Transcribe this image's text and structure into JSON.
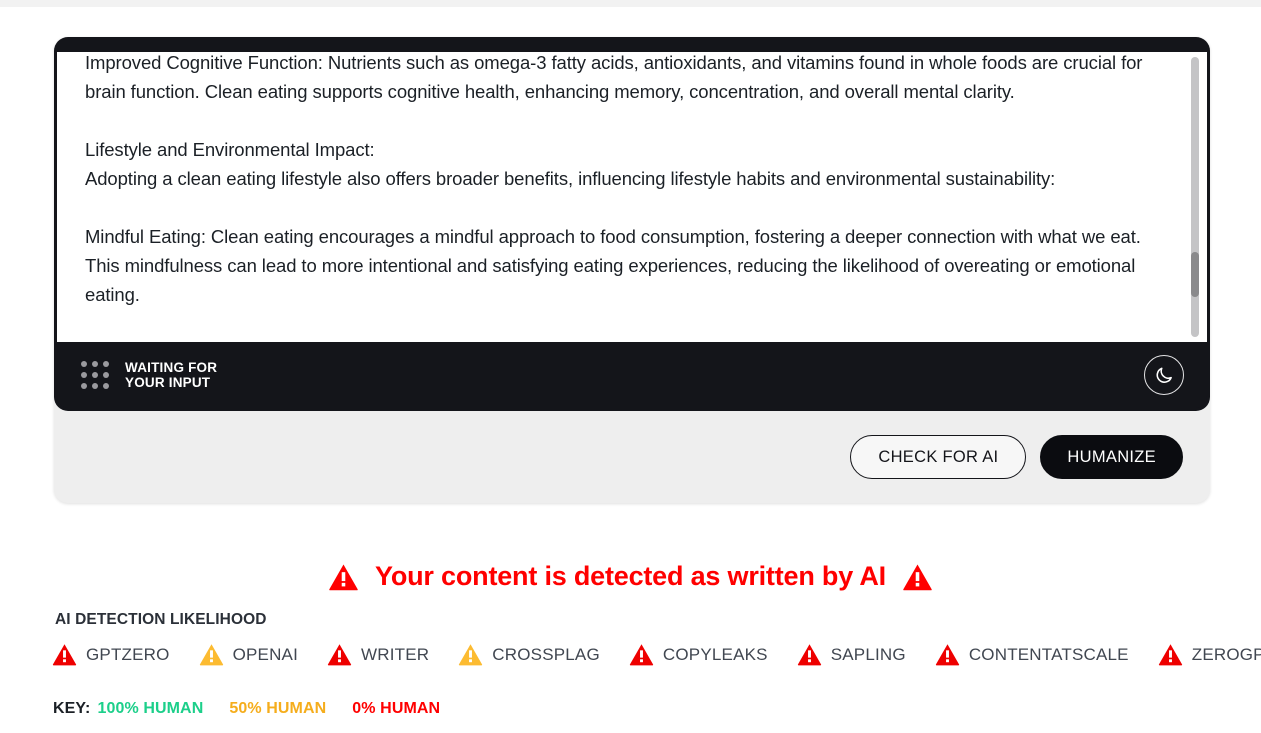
{
  "editor": {
    "body_text": "Improved Cognitive Function: Nutrients such as omega-3 fatty acids, antioxidants, and vitamins found in whole foods are crucial for brain function. Clean eating supports cognitive health, enhancing memory, concentration, and overall mental clarity.\n\nLifestyle and Environmental Impact:\nAdopting a clean eating lifestyle also offers broader benefits, influencing lifestyle habits and environmental sustainability:\n\nMindful Eating: Clean eating encourages a mindful approach to food consumption, fostering a deeper connection with what we eat. This mindfulness can lead to more intentional and satisfying eating experiences, reducing the likelihood of overeating or emotional eating.",
    "status_line1": "WAITING FOR",
    "status_line2": "YOUR INPUT",
    "dark_mode_icon": "moon-icon",
    "status_icon": "dot-grid-icon"
  },
  "actions": {
    "check_label": "CHECK FOR AI",
    "humanize_label": "HUMANIZE"
  },
  "alert": {
    "text": "Your content is detected as written by AI",
    "icon": "warning-triangle-icon",
    "color": "#ff0000"
  },
  "detection": {
    "section_label": "AI DETECTION LIKELIHOOD",
    "detectors": [
      {
        "name": "GPTZERO",
        "status": "red",
        "color": "#ee0000"
      },
      {
        "name": "OPENAI",
        "status": "amber",
        "color": "#fcbb31"
      },
      {
        "name": "WRITER",
        "status": "red",
        "color": "#ee0000"
      },
      {
        "name": "CROSSPLAG",
        "status": "amber",
        "color": "#fcbb31"
      },
      {
        "name": "COPYLEAKS",
        "status": "red",
        "color": "#ee0000"
      },
      {
        "name": "SAPLING",
        "status": "red",
        "color": "#ee0000"
      },
      {
        "name": "CONTENTATSCALE",
        "status": "red",
        "color": "#ee0000"
      },
      {
        "name": "ZEROGPT",
        "status": "red",
        "color": "#ee0000"
      }
    ]
  },
  "key": {
    "label": "KEY:",
    "items": [
      {
        "text": "100% HUMAN",
        "color": "#1ccf8a"
      },
      {
        "text": "50% HUMAN",
        "color": "#f5ad1c"
      },
      {
        "text": "0% HUMAN",
        "color": "#ff0000"
      }
    ]
  }
}
